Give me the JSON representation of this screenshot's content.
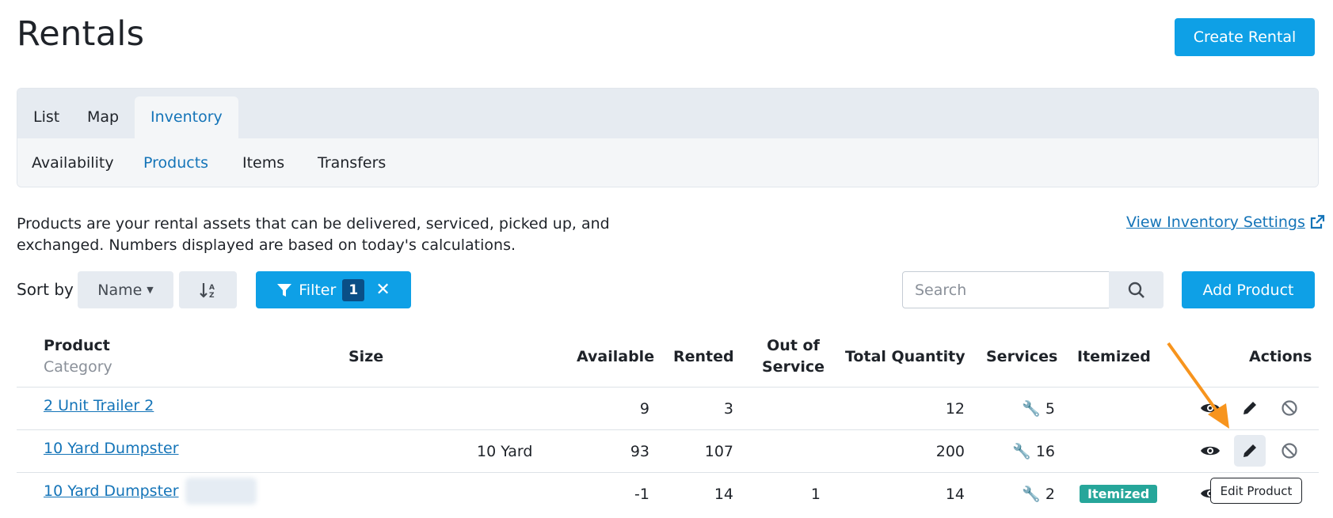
{
  "header": {
    "title": "Rentals",
    "create_button": "Create Rental"
  },
  "tabs": [
    {
      "label": "List",
      "active": false
    },
    {
      "label": "Map",
      "active": false
    },
    {
      "label": "Inventory",
      "active": true
    }
  ],
  "subtabs": [
    {
      "label": "Availability",
      "active": false
    },
    {
      "label": "Products",
      "active": true
    },
    {
      "label": "Items",
      "active": false
    },
    {
      "label": "Transfers",
      "active": false
    }
  ],
  "description": "Products are your rental assets that can be delivered, serviced, picked up, and exchanged. Numbers displayed are based on today's calculations.",
  "settings_link": "View Inventory Settings",
  "toolbar": {
    "sort_label": "Sort by",
    "sort_value": "Name",
    "filter_label": "Filter",
    "filter_count": "1",
    "search_placeholder": "Search",
    "add_button": "Add Product"
  },
  "table": {
    "columns": {
      "product": "Product",
      "category": "Category",
      "size": "Size",
      "available": "Available",
      "rented": "Rented",
      "out_of_service_1": "Out of",
      "out_of_service_2": "Service",
      "total_quantity": "Total Quantity",
      "services": "Services",
      "itemized": "Itemized",
      "actions": "Actions"
    },
    "rows": [
      {
        "product": "2 Unit Trailer 2",
        "size": "",
        "available": "9",
        "rented": "3",
        "out_of_service": "",
        "total_quantity": "12",
        "services": "5",
        "itemized": ""
      },
      {
        "product": "10 Yard Dumpster",
        "size": "10 Yard",
        "available": "93",
        "rented": "107",
        "out_of_service": "",
        "total_quantity": "200",
        "services": "16",
        "itemized": ""
      },
      {
        "product": "10 Yard Dumpster",
        "size": "",
        "available": "-1",
        "rented": "14",
        "out_of_service": "1",
        "total_quantity": "14",
        "services": "2",
        "itemized": "Itemized"
      }
    ]
  },
  "tooltip": "Edit Product",
  "colors": {
    "primary": "#0ea0e6",
    "link": "#1474b8",
    "badge": "#26a69a",
    "annotation_arrow": "#f7941d"
  }
}
